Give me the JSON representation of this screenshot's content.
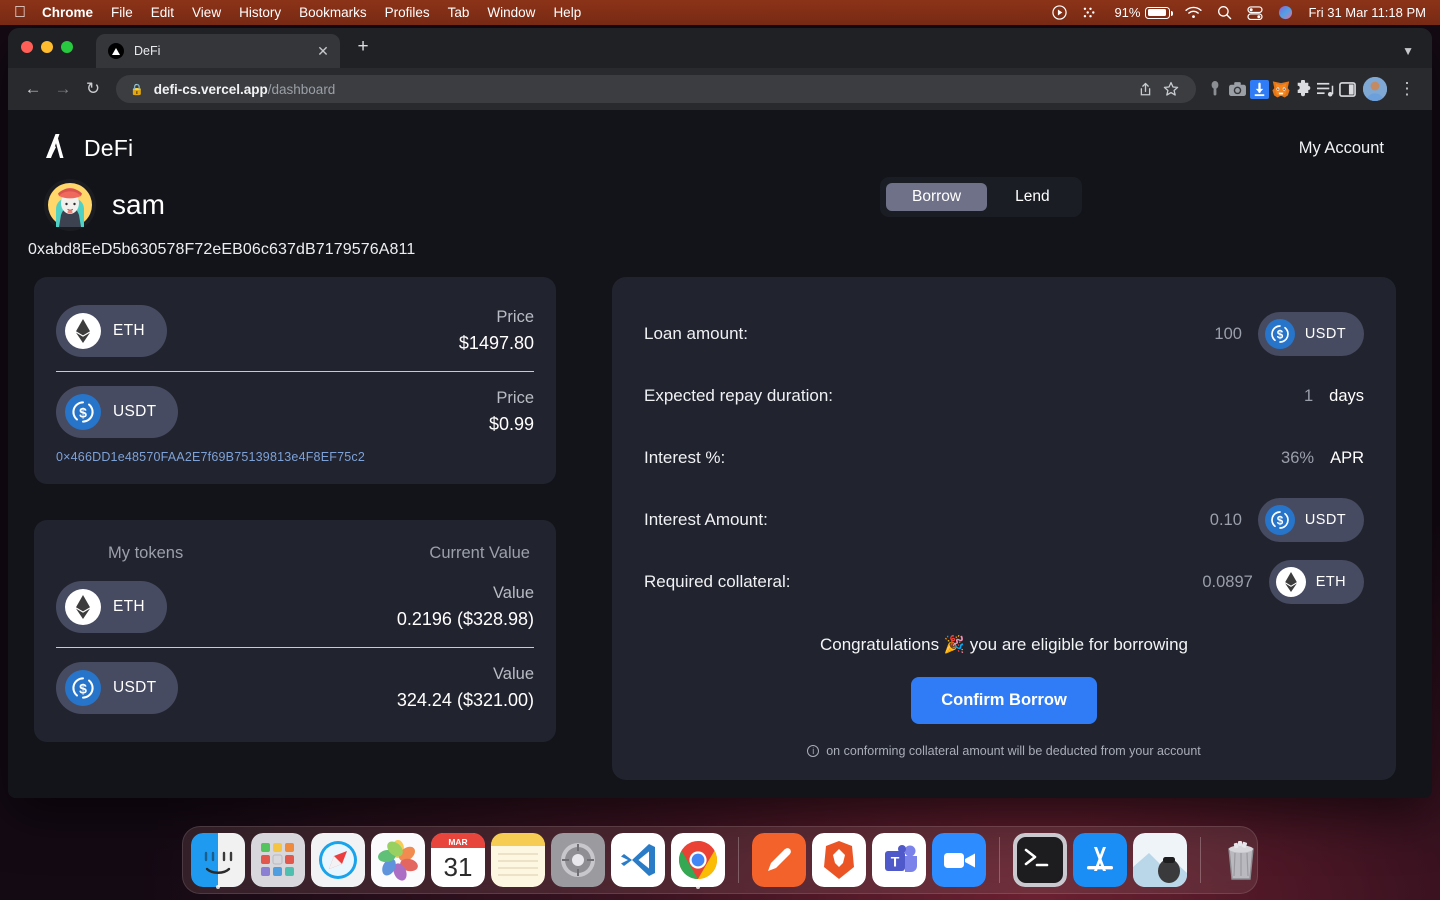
{
  "menubar": {
    "apple_icon": "apple-logo-icon",
    "items": [
      "Chrome",
      "File",
      "Edit",
      "View",
      "History",
      "Bookmarks",
      "Profiles",
      "Tab",
      "Window",
      "Help"
    ],
    "status": {
      "record_icon": "screen-record-icon",
      "control_center_icon": "control-center-icon",
      "battery_percent": "91%",
      "wifi_icon": "wifi-icon",
      "search_icon": "spotlight-search-icon",
      "siri_icon": "siri-icon",
      "datetime": "Fri 31 Mar  11:18 PM"
    }
  },
  "browser": {
    "tab": {
      "title": "DeFi",
      "favicon": "defi-triangle-icon",
      "close_icon": "close-icon"
    },
    "new_tab_icon": "plus-icon",
    "tab_list_icon": "chevron-down-icon",
    "nav": {
      "back_icon": "back-arrow-icon",
      "forward_icon": "forward-arrow-icon",
      "reload_icon": "reload-icon"
    },
    "omnibox": {
      "lock_icon": "lock-icon",
      "domain": "defi-cs.vercel.app",
      "path": "/dashboard",
      "full_url": "defi-cs.vercel.app/dashboard",
      "share_icon": "share-icon",
      "bookmark_icon": "star-icon"
    },
    "extensions": [
      "eyedropper-icon",
      "camera-icon",
      "download-manager-icon",
      "metamask-fox-icon",
      "puzzle-extensions-icon",
      "reading-list-icon",
      "side-panel-icon"
    ],
    "profile_icon": "profile-avatar-icon",
    "menu_icon": "three-dot-menu-icon"
  },
  "site": {
    "logo_icon": "algorand-a-logo-icon",
    "brand": "DeFi",
    "my_account": "My Account",
    "user": {
      "name": "sam",
      "avatar_icon": "user-avatar-icon"
    },
    "wallet_address": "0xabd8EeD5b630578F72eEB06c637dB7179576A811",
    "mode_tabs": [
      {
        "label": "Borrow",
        "active": true
      },
      {
        "label": "Lend",
        "active": false
      }
    ],
    "price_card": {
      "rows": [
        {
          "symbol": "ETH",
          "icon": "ethereum-coin-icon",
          "label": "Price",
          "value": "$1497.80"
        },
        {
          "symbol": "USDT",
          "icon": "usdt-coin-icon",
          "label": "Price",
          "value": "$0.99"
        }
      ],
      "contract_address": "0×466DD1e48570FAA2E7f69B75139813e4F8EF75c2"
    },
    "tokens_card": {
      "header_left": "My tokens",
      "header_right": "Current Value",
      "rows": [
        {
          "symbol": "ETH",
          "icon": "ethereum-coin-icon",
          "label": "Value",
          "value": "0.2196 ($328.98)"
        },
        {
          "symbol": "USDT",
          "icon": "usdt-coin-icon",
          "label": "Value",
          "value": "324.24 ($321.00)"
        }
      ]
    },
    "borrow_panel": {
      "fields": [
        {
          "label": "Loan amount:",
          "value": "100",
          "unit": "",
          "pill": "USDT",
          "pill_icon": "usdt-coin-icon"
        },
        {
          "label": "Expected repay duration:",
          "value": "1",
          "unit": "days",
          "pill": "",
          "pill_icon": ""
        },
        {
          "label": "Interest %:",
          "value": "36%",
          "unit": "APR",
          "pill": "",
          "pill_icon": ""
        },
        {
          "label": "Interest Amount:",
          "value": "0.10",
          "unit": "",
          "pill": "USDT",
          "pill_icon": "usdt-coin-icon"
        },
        {
          "label": "Required collateral:",
          "value": "0.0897",
          "unit": "",
          "pill": "ETH",
          "pill_icon": "ethereum-coin-icon"
        }
      ],
      "congrats": "Congratulations 🎉 you are eligible for borrowing",
      "confirm_label": "Confirm Borrow",
      "note_icon": "info-icon",
      "note": "on conforming collateral amount will be deducted from your account"
    }
  },
  "dock": {
    "items": [
      "finder-icon",
      "launchpad-icon",
      "safari-icon",
      "photos-icon",
      "calendar-icon",
      "notes-icon",
      "system-settings-icon",
      "vscode-icon",
      "chrome-icon",
      "sep",
      "postman-icon",
      "brave-icon",
      "microsoft-teams-icon",
      "zoom-icon",
      "sep",
      "terminal-icon",
      "app-store-icon",
      "preview-icon",
      "sep",
      "trash-icon"
    ],
    "calendar_month": "MAR",
    "calendar_day": "31"
  },
  "colors": {
    "accent_blue": "#2f7cf6",
    "page_bg": "#131419",
    "card_bg": "#21232e",
    "pill_bg": "#474b61",
    "link_blue": "#7ea2d8"
  }
}
